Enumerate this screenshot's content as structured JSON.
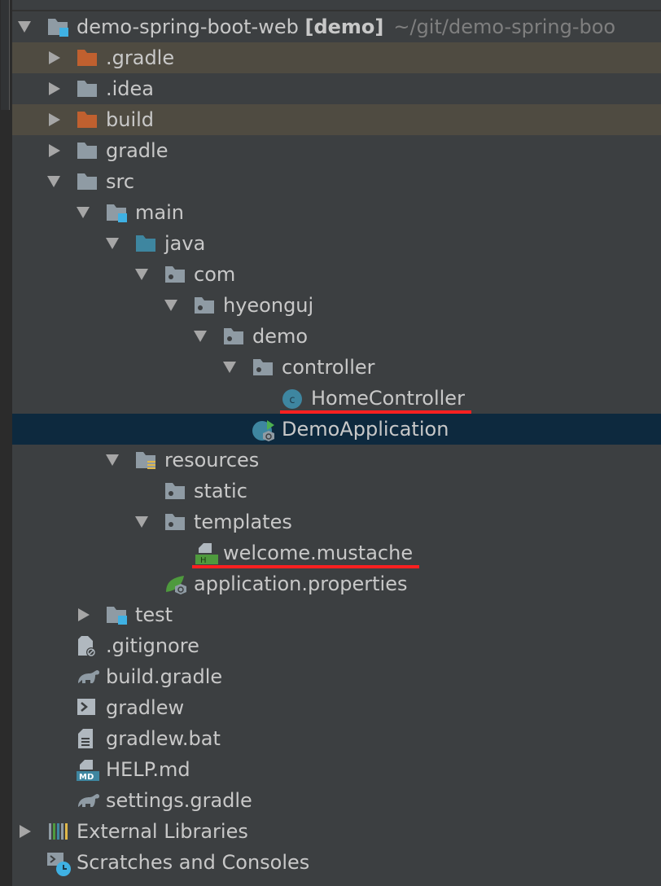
{
  "colors": {
    "background": "#3c3f41",
    "selected": "#0d293e",
    "ignored": "#4f4b41",
    "underline": "#ff2020",
    "folder": "#8f9ba4",
    "excluded_folder": "#c0602f",
    "source_folder": "#3e86a0"
  },
  "project": {
    "name": "demo-spring-boot-web",
    "module": "[demo]",
    "path": "~/git/demo-spring-boo"
  },
  "tree": [
    {
      "label": "demo-spring-boot-web",
      "level": 0,
      "arrow": "open",
      "icon": "module-folder-icon",
      "root": true
    },
    {
      "label": ".gradle",
      "level": 1,
      "arrow": "closed",
      "icon": "excluded-folder-icon",
      "ignored": true
    },
    {
      "label": ".idea",
      "level": 1,
      "arrow": "closed",
      "icon": "folder-icon"
    },
    {
      "label": "build",
      "level": 1,
      "arrow": "closed",
      "icon": "excluded-folder-icon",
      "ignored": true
    },
    {
      "label": "gradle",
      "level": 1,
      "arrow": "closed",
      "icon": "folder-icon"
    },
    {
      "label": "src",
      "level": 1,
      "arrow": "open",
      "icon": "folder-icon"
    },
    {
      "label": "main",
      "level": 2,
      "arrow": "open",
      "icon": "module-folder-icon"
    },
    {
      "label": "java",
      "level": 3,
      "arrow": "open",
      "icon": "source-folder-icon"
    },
    {
      "label": "com",
      "level": 4,
      "arrow": "open",
      "icon": "package-icon"
    },
    {
      "label": "hyeonguj",
      "level": 5,
      "arrow": "open",
      "icon": "package-icon"
    },
    {
      "label": "demo",
      "level": 6,
      "arrow": "open",
      "icon": "package-icon"
    },
    {
      "label": "controller",
      "level": 7,
      "arrow": "open",
      "icon": "package-icon"
    },
    {
      "label": "HomeController",
      "level": 8,
      "icon": "java-class-icon",
      "underline": true
    },
    {
      "label": "DemoApplication",
      "level": 7,
      "icon": "spring-boot-class-icon",
      "selected": true
    },
    {
      "label": "resources",
      "level": 3,
      "arrow": "open",
      "icon": "resources-folder-icon"
    },
    {
      "label": "static",
      "level": 4,
      "icon": "package-icon"
    },
    {
      "label": "templates",
      "level": 4,
      "arrow": "open",
      "icon": "package-icon"
    },
    {
      "label": "welcome.mustache",
      "level": 5,
      "icon": "html-file-icon",
      "underline": true
    },
    {
      "label": "application.properties",
      "level": 4,
      "icon": "spring-properties-icon"
    },
    {
      "label": "test",
      "level": 2,
      "arrow": "closed",
      "icon": "module-folder-icon"
    },
    {
      "label": ".gitignore",
      "level": 1,
      "icon": "ignore-file-icon"
    },
    {
      "label": "build.gradle",
      "level": 1,
      "icon": "gradle-icon"
    },
    {
      "label": "gradlew",
      "level": 1,
      "icon": "shell-script-icon"
    },
    {
      "label": "gradlew.bat",
      "level": 1,
      "icon": "text-file-icon"
    },
    {
      "label": "HELP.md",
      "level": 1,
      "icon": "markdown-icon"
    },
    {
      "label": "settings.gradle",
      "level": 1,
      "icon": "gradle-icon"
    },
    {
      "label": "External Libraries",
      "level": 0,
      "arrow": "closed",
      "icon": "libraries-icon"
    },
    {
      "label": "Scratches and Consoles",
      "level": 0,
      "icon": "scratches-icon"
    }
  ]
}
